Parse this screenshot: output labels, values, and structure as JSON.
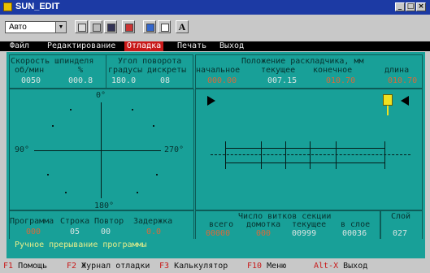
{
  "window": {
    "title": "SUN_EDIT"
  },
  "toolbar": {
    "combo_value": "Авто",
    "font_button": "A"
  },
  "menu": [
    {
      "label": "Файл"
    },
    {
      "label": "Редактирование"
    },
    {
      "label": "Отладка",
      "selected": true
    },
    {
      "label": "Печать"
    },
    {
      "label": "Выход"
    }
  ],
  "panel_speed": {
    "title": "Скорость шпинделя",
    "col1": "об/мин",
    "col2": "%",
    "v1": "0050",
    "v2": "000.8"
  },
  "panel_angle": {
    "title": "Угол поворота",
    "col1": "градусы",
    "col2": "дискреты",
    "v1": "180.0",
    "v2": "08"
  },
  "panel_position": {
    "title": "Положение раскладчика, мм",
    "cols": [
      "начальное",
      "текущее",
      "конечное",
      "длина"
    ],
    "values": [
      "000.00",
      "007.15",
      "010.70",
      "010.70"
    ]
  },
  "dial": {
    "top": "0°",
    "left": "90°",
    "right": "270°",
    "bottom": "180°"
  },
  "panel_program": {
    "cols": [
      "Программа",
      "Строка",
      "Повтор",
      "Задержка"
    ],
    "values": [
      "000",
      "05",
      "00",
      "0.0"
    ]
  },
  "panel_turns": {
    "title": "Число витков секции",
    "cols": [
      "всего",
      "домотка",
      "текущее",
      "в слое"
    ],
    "values": [
      "00000",
      "000",
      "00999",
      "00036"
    ]
  },
  "panel_layer": {
    "title": "Слой",
    "value": "027"
  },
  "status": "Ручное прерывание программы",
  "fkeys": [
    {
      "key": "F1",
      "label": "Помощь"
    },
    {
      "key": "F2",
      "label": "Журнал отладки"
    },
    {
      "key": "F3",
      "label": "Калькулятор"
    },
    {
      "key": "F10",
      "label": "Меню"
    },
    {
      "key": "Alt-X",
      "label": "Выход"
    }
  ]
}
